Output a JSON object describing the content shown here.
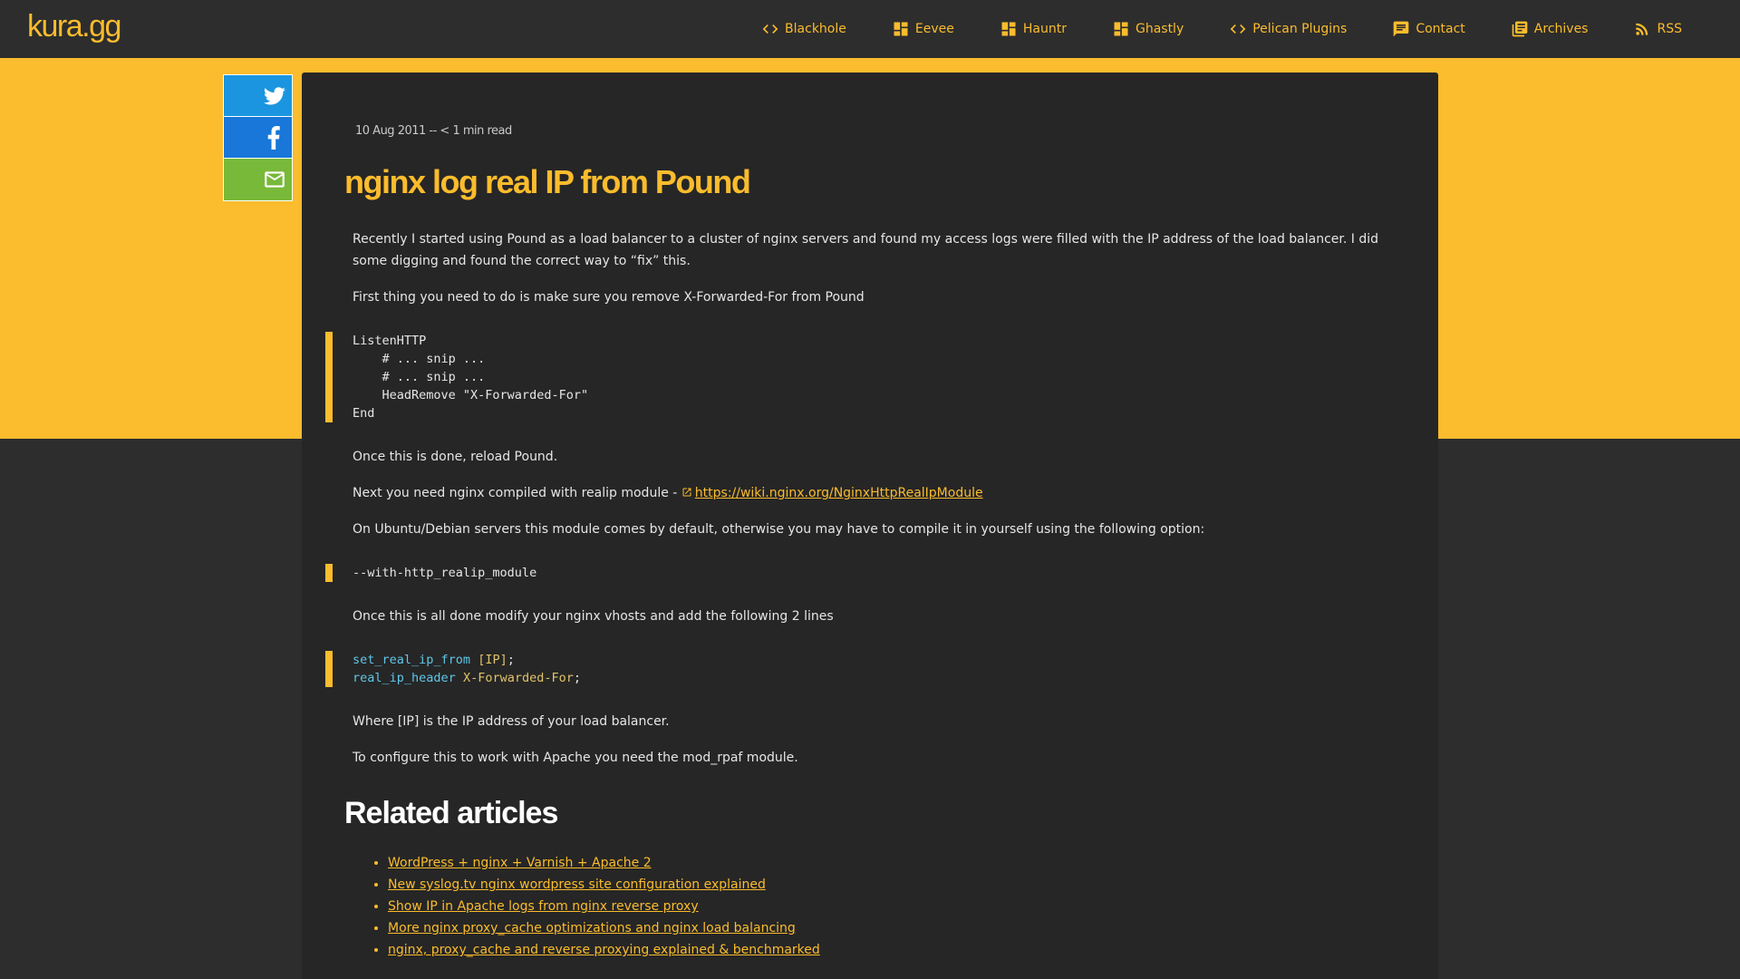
{
  "site": {
    "logo": "kura.gg"
  },
  "nav": [
    {
      "label": "Blackhole",
      "icon": "code-icon"
    },
    {
      "label": "Eevee",
      "icon": "dashboard-icon"
    },
    {
      "label": "Hauntr",
      "icon": "dashboard-icon"
    },
    {
      "label": "Ghastly",
      "icon": "dashboard-icon"
    },
    {
      "label": "Pelican Plugins",
      "icon": "code-icon"
    },
    {
      "label": "Contact",
      "icon": "chat-icon"
    },
    {
      "label": "Archives",
      "icon": "library-icon"
    },
    {
      "label": "RSS",
      "icon": "rss-icon"
    }
  ],
  "share": [
    "twitter-icon",
    "facebook-icon",
    "email-icon"
  ],
  "colors": {
    "accent": "#fbbc2d",
    "background": "#2d2d2d",
    "article": "#262626"
  },
  "article": {
    "meta": "10 Aug 2011 -- < 1 min read",
    "title": "nginx log real IP from Pound",
    "p1": "Recently I started using Pound as a load balancer to a cluster of nginx servers and found my access logs were filled with the IP address of the load balancer. I did some digging and found the correct way to “fix” this.",
    "p2": "First thing you need to do is make sure you remove X-Forwarded-For from Pound",
    "code1": "ListenHTTP\n    # ... snip ...\n    # ... snip ...\n    HeadRemove \"X-Forwarded-For\"\nEnd",
    "p3": "Once this is done, reload Pound.",
    "p4_prefix": "Next you need nginx compiled with realip module - ",
    "p4_link": "https://wiki.nginx.org/NginxHttpRealIpModule",
    "p5": "On Ubuntu/Debian servers this module comes by default, otherwise you may have to compile it in yourself using the following option:",
    "code2": "--with-http_realip_module",
    "p6": "Once this is all done modify your nginx vhosts and add the following 2 lines",
    "code3": {
      "line1_directive": "set_real_ip_from",
      "line1_value": "[IP]",
      "line2_directive": "real_ip_header",
      "line2_value": "X-Forwarded-For",
      "terminator": ";"
    },
    "p7": "Where [IP] is the IP address of your load balancer.",
    "p8": "To configure this to work with Apache you need the mod_rpaf module."
  },
  "related": {
    "title": "Related articles",
    "items": [
      "WordPress + nginx + Varnish + Apache 2",
      "New syslog.tv nginx wordpress site configuration explained",
      "Show IP in Apache logs from nginx reverse proxy",
      "More nginx proxy_cache optimizations and nginx load balancing",
      "nginx, proxy_cache and reverse proxying explained & benchmarked"
    ]
  }
}
